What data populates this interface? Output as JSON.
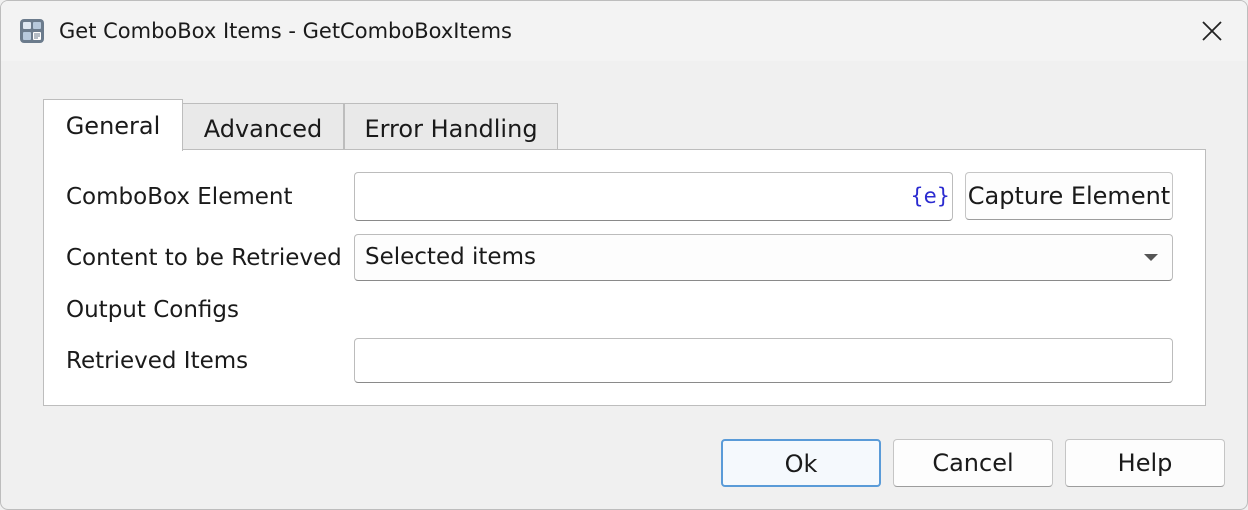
{
  "window": {
    "title": "Get ComboBox Items - GetComboBoxItems",
    "app_icon": "workflow-app-icon",
    "close_icon": "close-icon"
  },
  "tabs": [
    {
      "label": "General",
      "active": true
    },
    {
      "label": "Advanced",
      "active": false
    },
    {
      "label": "Error Handling",
      "active": false
    }
  ],
  "general": {
    "combobox_element_label": "ComboBox Element",
    "combobox_element_value": "",
    "expression_icon_text": "{e}",
    "capture_element_label": "Capture Element",
    "content_label": "Content to be Retrieved",
    "content_selected": "Selected items",
    "output_configs_label": "Output Configs",
    "retrieved_items_label": "Retrieved Items",
    "retrieved_items_value": ""
  },
  "footer": {
    "ok_label": "Ok",
    "cancel_label": "Cancel",
    "help_label": "Help"
  },
  "colors": {
    "accent": "#0067c0",
    "expression": "#2b2bd0"
  }
}
